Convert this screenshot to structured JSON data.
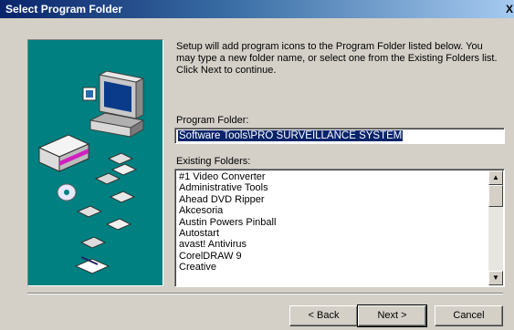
{
  "window": {
    "title": "Select Program Folder",
    "close_glyph": "X"
  },
  "intro_text": "Setup will add program icons to the Program Folder listed below. You may type a new folder name, or select one from the Existing Folders list. Click Next to continue.",
  "program_folder": {
    "label": "Program Folder:",
    "value": "Software Tools\\PRO SURVEILLANCE SYSTEM"
  },
  "existing_folders": {
    "label": "Existing Folders:",
    "items": [
      "#1 Video Converter",
      "Administrative Tools",
      "Ahead DVD Ripper",
      "Akcesoria",
      "Austin Powers Pinball",
      "Autostart",
      "avast! Antivirus",
      "CorelDRAW 9",
      "Creative"
    ]
  },
  "buttons": {
    "back": "< Back",
    "next": "Next >",
    "cancel": "Cancel"
  },
  "artwork": {
    "name": "setup-computer-disks-illustration",
    "background": "#008080"
  }
}
